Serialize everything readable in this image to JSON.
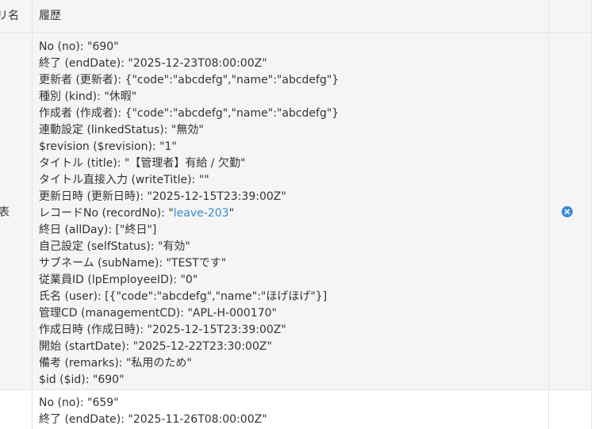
{
  "header": {
    "col1": "リ名",
    "col2": "履歴"
  },
  "row1": {
    "left_label": "表",
    "lines": [
      {
        "key": "No (no): ",
        "value": "\"690\""
      },
      {
        "key": "終了 (endDate): ",
        "value": "\"2025-12-23T08:00:00Z\""
      },
      {
        "key": "更新者 (更新者): ",
        "value": "{\"code\":\"abcdefg\",\"name\":\"abcdefg\"}"
      },
      {
        "key": "種別 (kind): ",
        "value": "\"休暇\""
      },
      {
        "key": "作成者 (作成者): ",
        "value": "{\"code\":\"abcdefg\",\"name\":\"abcdefg\"}"
      },
      {
        "key": "連動設定 (linkedStatus): ",
        "value": "\"無効\""
      },
      {
        "key": "$revision ($revision): ",
        "value": "\"1\""
      },
      {
        "key": "タイトル (title): ",
        "value": "\"【管理者】有給 / 欠勤\""
      },
      {
        "key": "タイトル直接入力 (writeTitle): ",
        "value": "\"\""
      },
      {
        "key": "更新日時 (更新日時): ",
        "value": "\"2025-12-15T23:39:00Z\""
      },
      {
        "key": "レコードNo (recordNo): ",
        "value": "\"",
        "link": "leave-203",
        "value_after": "\""
      },
      {
        "key": "終日 (allDay): ",
        "value": "[\"終日\"]"
      },
      {
        "key": "自己設定 (selfStatus): ",
        "value": "\"有効\""
      },
      {
        "key": "サブネーム (subName): ",
        "value": "\"TESTです\""
      },
      {
        "key": "従業員ID (lpEmployeeID): ",
        "value": "\"0\""
      },
      {
        "key": "氏名 (user): ",
        "value": "[{\"code\":\"abcdefg\",\"name\":\"ほげほげ\"}]"
      },
      {
        "key": "管理CD (managementCD): ",
        "value": "\"APL-H-000170\""
      },
      {
        "key": "作成日時 (作成日時): ",
        "value": "\"2025-12-15T23:39:00Z\""
      },
      {
        "key": "開始 (startDate): ",
        "value": "\"2025-12-22T23:30:00Z\""
      },
      {
        "key": "備考 (remarks): ",
        "value": "\"私用のため\""
      },
      {
        "key": "$id ($id): ",
        "value": "\"690\""
      }
    ],
    "remove_icon": "close-circle-icon"
  },
  "row2": {
    "lines": [
      {
        "key": "No (no): ",
        "value": "\"659\""
      },
      {
        "key": "終了 (endDate): ",
        "value": "\"2025-11-26T08:00:00Z\""
      }
    ]
  },
  "colors": {
    "link": "#3a8cd2",
    "row_bg": "#f5f5f5",
    "border": "#e3e3e3"
  }
}
